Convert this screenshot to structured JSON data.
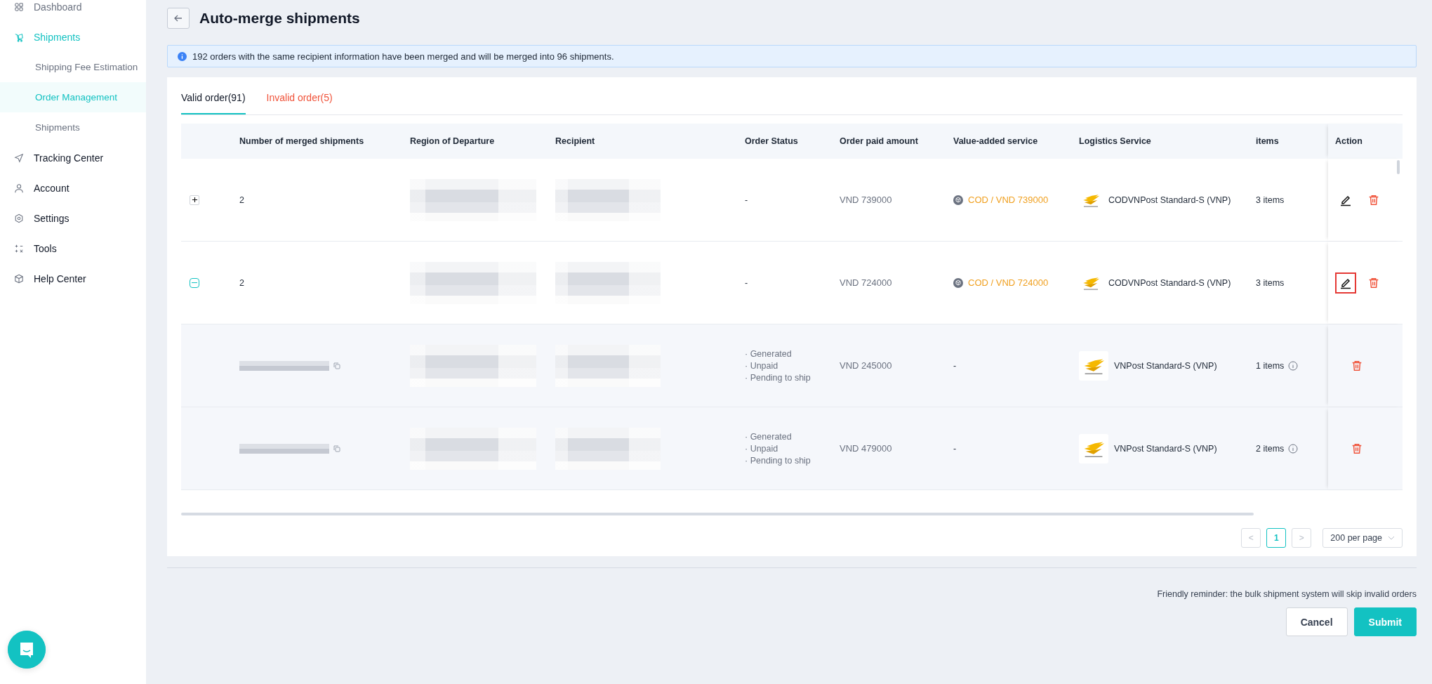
{
  "sidebar": {
    "items": [
      {
        "label": "Dashboard",
        "selected": false
      },
      {
        "label": "Shipments",
        "selected": true,
        "children": [
          {
            "label": "Shipping Fee Estimation",
            "selected": false
          },
          {
            "label": "Order Management",
            "selected": true
          },
          {
            "label": "Shipments",
            "selected": false
          }
        ]
      },
      {
        "label": "Tracking Center",
        "selected": false
      },
      {
        "label": "Account",
        "selected": false
      },
      {
        "label": "Settings",
        "selected": false
      },
      {
        "label": "Tools",
        "selected": false
      },
      {
        "label": "Help Center",
        "selected": false
      }
    ]
  },
  "header": {
    "title": "Auto-merge shipments"
  },
  "info": "192 orders with the same recipient information have been merged and will be merged into 96 shipments.",
  "tabs": [
    {
      "label": "Valid order(91)",
      "selected": true
    },
    {
      "label": "Invalid order(5)",
      "selected": false
    }
  ],
  "table": {
    "columns": [
      "Number of merged shipments",
      "Region of Departure",
      "Recipient",
      "Order Status",
      "Order paid amount",
      "Value-added service",
      "Logistics Service",
      "items",
      "Action"
    ],
    "rows": [
      {
        "kind": "group",
        "expanded": false,
        "merged": "2",
        "status": "-",
        "paid": "VND  739000",
        "vas": "COD / VND  739000",
        "logistics": "CODVNPost Standard-S (VNP)",
        "items": "3 items",
        "highlighted": false
      },
      {
        "kind": "group",
        "expanded": true,
        "merged": "2",
        "status": "-",
        "paid": "VND  724000",
        "vas": "COD / VND  724000",
        "logistics": "CODVNPost Standard-S (VNP)",
        "items": "3 items",
        "highlighted": true
      },
      {
        "kind": "order",
        "statuses": [
          "· Generated",
          "· Unpaid",
          "· Pending to ship"
        ],
        "paid": "VND  245000",
        "vas": "-",
        "logistics": "VNPost Standard-S (VNP)",
        "items": "1 items"
      },
      {
        "kind": "order",
        "statuses": [
          "· Generated",
          "· Unpaid",
          "· Pending to ship"
        ],
        "paid": "VND  479000",
        "vas": "-",
        "logistics": "VNPost Standard-S (VNP)",
        "items": "2 items"
      }
    ]
  },
  "pagination": {
    "prev": "<",
    "pages": [
      {
        "label": "1",
        "selected": true
      }
    ],
    "next": ">",
    "page_size": "200 per page"
  },
  "reminder": "Friendly reminder: the bulk shipment system will skip invalid orders",
  "buttons": [
    {
      "label": "Cancel",
      "kind": "secondary"
    },
    {
      "label": "Submit",
      "kind": "primary"
    }
  ]
}
